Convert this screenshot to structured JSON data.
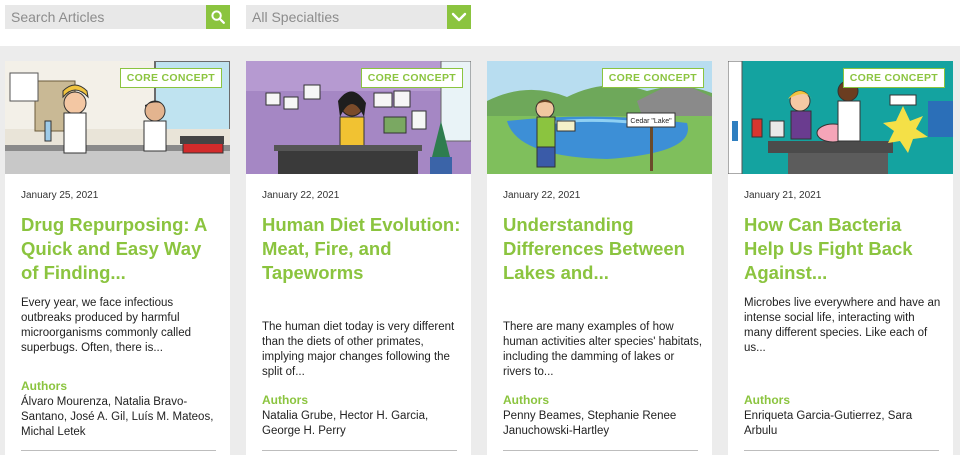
{
  "search": {
    "placeholder": "Search Articles"
  },
  "filter": {
    "selected": "All Specialties"
  },
  "colors": {
    "accent": "#8bc43f",
    "background": "#ececec"
  },
  "articles": [
    {
      "badge": "CORE CONCEPT",
      "date": "January 25, 2021",
      "title": "Drug Repurposing: A Quick and Easy Way of Finding...",
      "excerpt": "Every year, we face infectious outbreaks produced by harmful microorganisms commonly called superbugs. Often, there is...",
      "authors_label": "Authors",
      "authors": "Álvaro Mourenza, Natalia Bravo-Santano, José A. Gil, Luís M. Mateos, Michal Letek",
      "illustration": "lab-scientists"
    },
    {
      "badge": "CORE CONCEPT",
      "date": "January 22, 2021",
      "title": "Human Diet Evolution: Meat, Fire, and Tapeworms",
      "excerpt": "The human diet today is very different than the diets of other primates, implying major changes following the split of...",
      "authors_label": "Authors",
      "authors": "Natalia Grube, Hector H. Garcia, George H. Perry",
      "illustration": "diet-researcher"
    },
    {
      "badge": "CORE CONCEPT",
      "date": "January 22, 2021",
      "title": "Understanding Differences Between Lakes and...",
      "excerpt": "There are many examples of how human activities alter species' habitats, including the damming of lakes or rivers to...",
      "authors_label": "Authors",
      "authors": "Penny Beames, Stephanie Renee Januchowski-Hartley",
      "illustration": "lake-explorer",
      "sign": "Cedar \"Lake\""
    },
    {
      "badge": "CORE CONCEPT",
      "date": "January 21, 2021",
      "title": "How Can Bacteria Help Us Fight Back Against...",
      "excerpt": "Microbes live everywhere and have an intense social life, interacting with many different species. Like each of us...",
      "authors_label": "Authors",
      "authors": "Enriqueta Garcia-Gutierrez, Sara Arbulu",
      "illustration": "vet-clinic"
    }
  ]
}
